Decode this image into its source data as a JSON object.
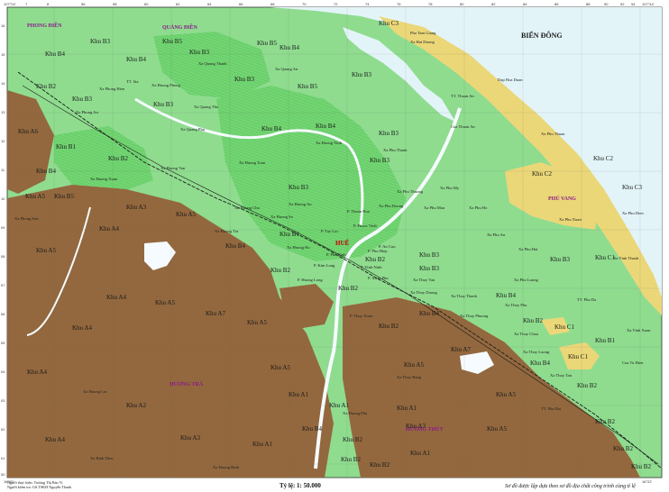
{
  "colors": {
    "sea": "#e3f4f8",
    "mid_green": "#8fdc8f",
    "light_green": "#6fd36f",
    "dark_green": "#4fc24f",
    "hill_brown": "#93683e",
    "sand_yellow": "#ecd97a",
    "river": "#f5fbff",
    "road": "#1a1a1a",
    "district_text": "#8b1a8b",
    "city_text": "#c00000"
  },
  "sea_label": "BIỂN ĐÔNG",
  "city_label": "HUẾ",
  "districts": [
    "PHONG ĐIỀN",
    "QUẢNG ĐIỀN",
    "PHÚ VANG",
    "HƯƠNG TRÀ",
    "HƯƠNG THỦY"
  ],
  "zones": {
    "b1": "Khu B1",
    "b2": "Khu B2",
    "b3": "Khu B3",
    "b4": "Khu B4",
    "b5": "Khu B5",
    "a1": "Khu A1",
    "a2": "Khu A2",
    "a3": "Khu A3",
    "a4": "Khu A4",
    "a5": "Khu A5",
    "a6": "Khu A6",
    "a7": "Khu A7",
    "c1": "Khu C1",
    "c2": "Khu C2",
    "c3": "Khu C3"
  },
  "places": {
    "quang_thanh": "Xa Quang Thanh",
    "quang_an": "Xa Quang An",
    "quang_tho": "Xa Quang Tho",
    "quang_phu": "Xa Quang Phu",
    "huong_phong": "Xa Huong Phong",
    "huong_vinh": "Xa Huong Vinh",
    "huong_toan": "Xa Huong Toan",
    "huong_van": "Xa Huong Van",
    "huong_xuan": "Xa Huong Xuan",
    "huong_chu": "Xa Huong Chu",
    "huong_so": "Xa Huong So",
    "huong_tra": "Xa Huong Tra",
    "phu_thanh": "Xa Phu Thanh",
    "phu_mau": "Xa Phu Mau",
    "phu_my": "Xa Phu My",
    "phu_thuong": "Xa Phu Thuong",
    "phu_duong": "Xa Phu Duong",
    "phu_luong": "Xa Phu Luong",
    "phu_hai": "Xa Phu Hai",
    "phu_dien": "Xa Phu Dien",
    "phu_thuan": "Xa Phu Thuan",
    "phu_xuan": "Xa Phu Xuan",
    "phu_thanh2": "Xa Phu Thanh",
    "phu_an": "Xa Phu An",
    "phu_ho": "Xa Phu Ho",
    "vinh_thanh": "Xa Vinh Thanh",
    "vinh_xuan": "Xa Vinh Xuan",
    "thuy_van": "Xa Thuy Van",
    "thuy_thanh": "Xa Thuy Thanh",
    "thuy_chau": "Xa Thuy Chau",
    "thuy_phu": "Xa Thuy Phu",
    "thuy_duong": "Xa Thuy Duong",
    "thuy_tan": "Xa Thuy Tan",
    "thuy_bang": "Xa Thuy Bang",
    "thuy_luong": "Xa Thuy Luong",
    "thuy_phuong": "Xa Thuy Phuong",
    "hai_duong": "Xa Hai Duong",
    "thuan_an": "TT. Thuan An",
    "thuan_hoa": "P. Thuan Hoa",
    "vinh_ninh": "P. Vinh Ninh",
    "kim_long": "P. Kim Long",
    "an_cuu": "P. An Cuu",
    "xuan_phu": "P. Xuan Phu",
    "phu_hiep": "P. Phu Hiep",
    "tay_loc": "P. Tay Loc",
    "phu_binh": "P. Phu Binh",
    "phuoc_vinh": "P. Phuoc Vinh",
    "huong_an": "Xa Huong An",
    "huong_ho": "Xa Huong Ho",
    "huong_long": "P. Huong Long",
    "thuy_xuan": "P. Thuy Xuan",
    "phu_bai": "TT. Phu Bai",
    "huong_binh": "Xa Huong Binh",
    "binh_dien": "Xa Binh Dien",
    "huong_phu": "Xa Huong Phu",
    "huong_loc": "Xa Huong Loc",
    "phu_da": "TT. Phu Da",
    "tu_hien": "Cua Tu Hien",
    "thuan_an_mouth": "Cua Thuan An",
    "hoa_duan": "Dap Hoa Duan",
    "tam_giang": "Pha Tam Giang",
    "sia": "TT. Sia",
    "phong_hien": "Xa Phong Hien",
    "phong_an": "Xa Phong An",
    "phong_son": "Xa Phong Son"
  },
  "coords": {
    "top": [
      "7",
      " 8",
      "56",
      "58",
      "60",
      "62",
      "64",
      "66",
      "68",
      "70",
      "72",
      "74",
      "76",
      "78",
      "80",
      "82",
      "84",
      "86",
      "88",
      "90",
      "92",
      "94"
    ],
    "left": [
      "16",
      "15",
      "14",
      "13",
      "12",
      "11",
      "10",
      "09",
      "08",
      "07",
      "06",
      "05",
      "04",
      "03",
      "02",
      "01",
      "00"
    ]
  },
  "corner_top_left": "107°24'",
  "corner_top_right": "107°44'",
  "corner_bottom_left": "16°20'",
  "corner_bottom_right": "16°22'",
  "scale": "Tỷ lệ: 1: 50.000",
  "note": "Sơ đồ được lập dựa theo sơ đồ địa chất công trình cùng tỉ lệ",
  "credit_1": "Người thực hiện: Trương Thị Bảo Vi",
  "credit_2": "Người kiểm tra: GS.TSKH Nguyễn Thanh"
}
